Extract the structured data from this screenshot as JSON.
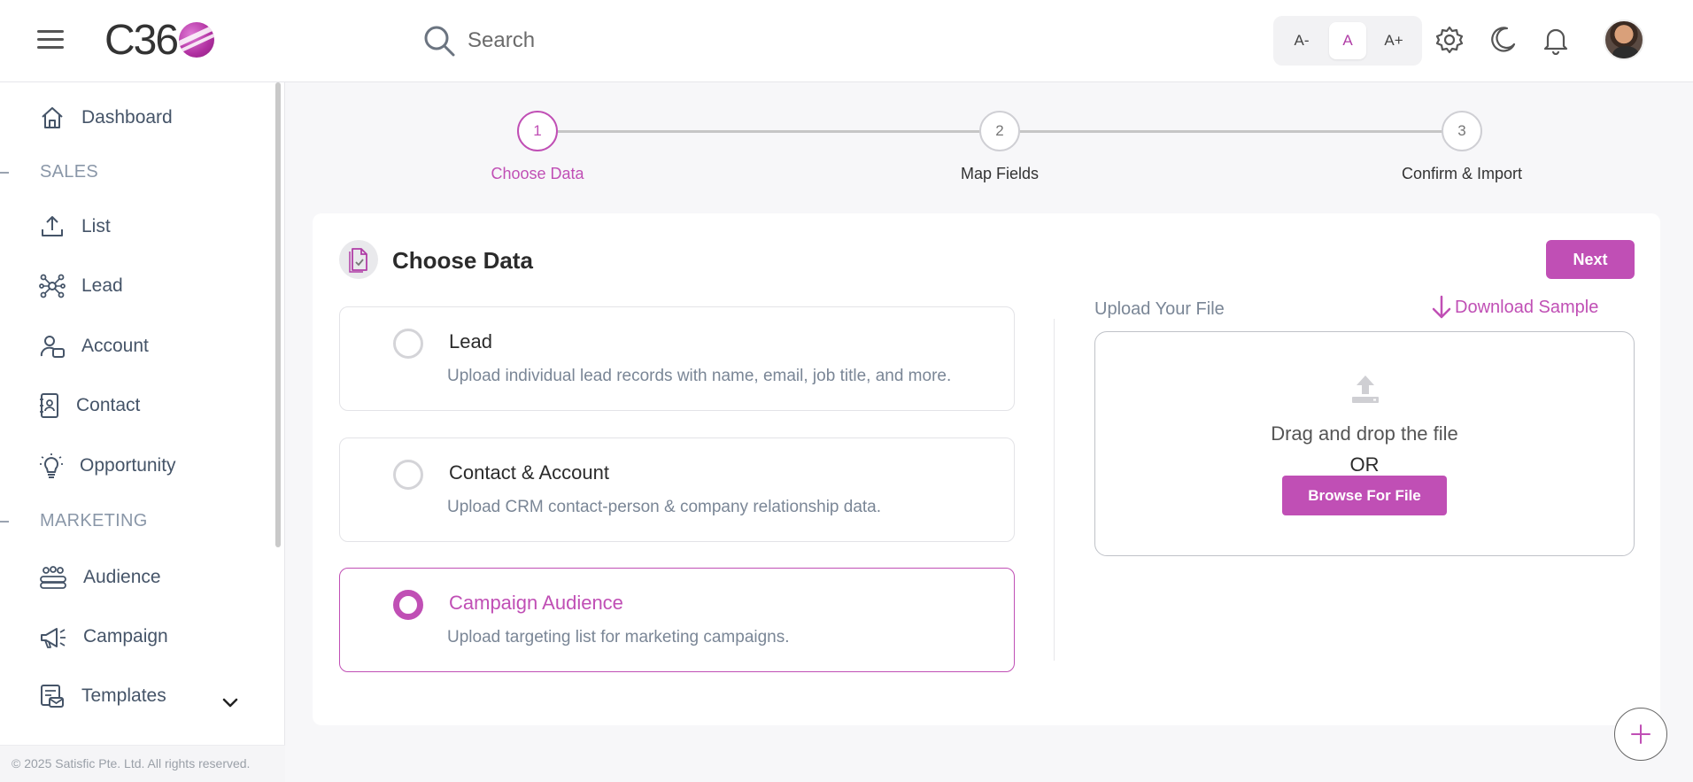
{
  "header": {
    "logo_text": "C36",
    "search_placeholder": "Search",
    "font_sizes": [
      "A-",
      "A",
      "A+"
    ],
    "active_font_size": "A",
    "icons": [
      "menu-icon",
      "search-icon",
      "gear-icon",
      "moon-icon",
      "bell-icon"
    ]
  },
  "sidebar": {
    "items": [
      {
        "label": "Dashboard",
        "icon": "home-icon"
      },
      {
        "label": "List",
        "icon": "upload-icon"
      },
      {
        "label": "Lead",
        "icon": "network-icon"
      },
      {
        "label": "Account",
        "icon": "user-card-icon"
      },
      {
        "label": "Contact",
        "icon": "contact-book-icon"
      },
      {
        "label": "Opportunity",
        "icon": "lightbulb-icon"
      },
      {
        "label": "Audience",
        "icon": "people-icon"
      },
      {
        "label": "Campaign",
        "icon": "megaphone-icon"
      },
      {
        "label": "Templates",
        "icon": "template-icon"
      }
    ],
    "sections": [
      "SALES",
      "MARKETING"
    ],
    "footer": "© 2025 Satisfic Pte. Ltd. All rights reserved."
  },
  "stepper": {
    "steps": [
      {
        "number": "1",
        "label": "Choose Data"
      },
      {
        "number": "2",
        "label": "Map Fields"
      },
      {
        "number": "3",
        "label": "Confirm & Import"
      }
    ],
    "active_step": 1
  },
  "card": {
    "title": "Choose Data",
    "next_label": "Next",
    "options": [
      {
        "title": "Lead",
        "description": "Upload individual lead records with name, email, job title, and more."
      },
      {
        "title": "Contact & Account",
        "description": "Upload CRM contact-person & company relationship data."
      },
      {
        "title": "Campaign Audience",
        "description": "Upload targeting list for marketing campaigns."
      }
    ],
    "selected_option": "Campaign Audience",
    "upload_label": "Upload Your File",
    "download_label": "Download Sample",
    "drop_text": "Drag and drop the file",
    "or_text": "OR",
    "browse_label": "Browse For File"
  },
  "colors": {
    "accent": "#c04fb5",
    "sidebar_text": "#455468",
    "muted_text": "#7a8696"
  }
}
